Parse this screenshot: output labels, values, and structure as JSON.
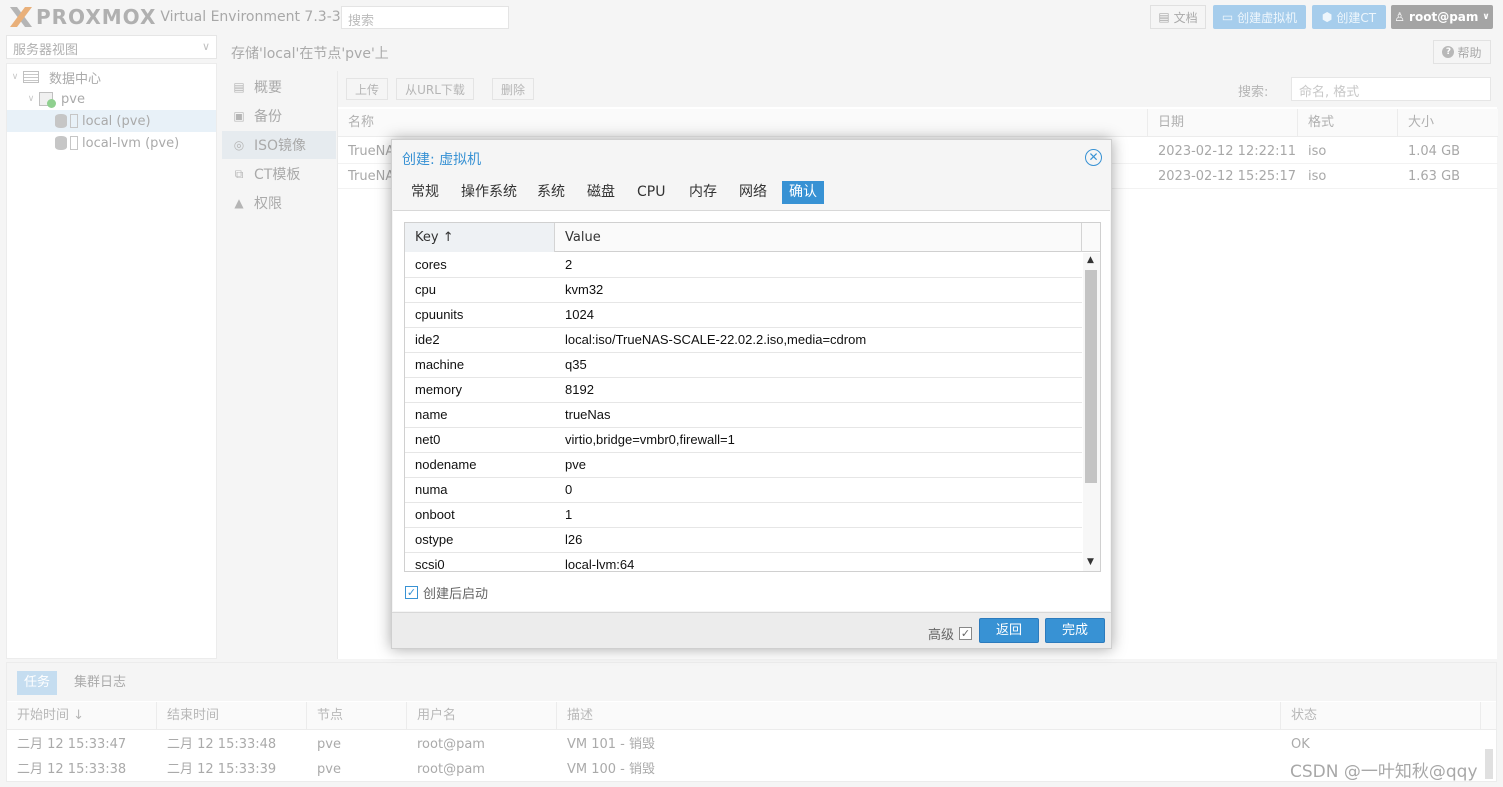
{
  "topbar": {
    "logo_text": "PROXMOX",
    "version": "Virtual Environment 7.3-3",
    "search_placeholder": "搜索",
    "docs_label": "文档",
    "create_vm_label": "创建虚拟机",
    "create_ct_label": "创建CT",
    "user_label": "root@pam"
  },
  "tree": {
    "view_label": "服务器视图",
    "items": [
      {
        "label": "数据中心",
        "icon": "datacenter-icon"
      },
      {
        "label": "pve",
        "icon": "node-icon"
      },
      {
        "label": "local (pve)",
        "icon": "storage-icon"
      },
      {
        "label": "local-lvm (pve)",
        "icon": "storage-icon"
      }
    ]
  },
  "content": {
    "title": "存储'local'在节点'pve'上",
    "help_label": "帮助"
  },
  "side_menu": {
    "items": [
      {
        "label": "概要",
        "icon": "book-icon"
      },
      {
        "label": "备份",
        "icon": "floppy-icon"
      },
      {
        "label": "ISO镜像",
        "icon": "disc-icon"
      },
      {
        "label": "CT模板",
        "icon": "template-icon"
      },
      {
        "label": "权限",
        "icon": "unlock-icon"
      }
    ]
  },
  "iso": {
    "upload_label": "上传",
    "download_url_label": "从URL下载",
    "delete_label": "删除",
    "search_label": "搜索:",
    "search_placeholder": "命名, 格式",
    "columns": [
      "名称",
      "日期",
      "格式",
      "大小"
    ],
    "rows": [
      {
        "name": "TrueNA",
        "date": "2023-02-12 12:22:11",
        "format": "iso",
        "size": "1.04 GB"
      },
      {
        "name": "TrueNA",
        "date": "2023-02-12 15:25:17",
        "format": "iso",
        "size": "1.63 GB"
      }
    ]
  },
  "modal": {
    "title": "创建: 虚拟机",
    "tabs": [
      "常规",
      "操作系统",
      "系统",
      "磁盘",
      "CPU",
      "内存",
      "网络",
      "确认"
    ],
    "active_tab": "确认",
    "key_header": "Key ↑",
    "value_header": "Value",
    "rows": [
      {
        "key": "cores",
        "value": "2"
      },
      {
        "key": "cpu",
        "value": "kvm32"
      },
      {
        "key": "cpuunits",
        "value": "1024"
      },
      {
        "key": "ide2",
        "value": "local:iso/TrueNAS-SCALE-22.02.2.iso,media=cdrom"
      },
      {
        "key": "machine",
        "value": "q35"
      },
      {
        "key": "memory",
        "value": "8192"
      },
      {
        "key": "name",
        "value": "trueNas"
      },
      {
        "key": "net0",
        "value": "virtio,bridge=vmbr0,firewall=1"
      },
      {
        "key": "nodename",
        "value": "pve"
      },
      {
        "key": "numa",
        "value": "0"
      },
      {
        "key": "onboot",
        "value": "1"
      },
      {
        "key": "ostype",
        "value": "l26"
      },
      {
        "key": "scsi0",
        "value": "local-lvm:64"
      }
    ],
    "start_after_create_label": "创建后启动",
    "advanced_label": "高级",
    "back_label": "返回",
    "finish_label": "完成"
  },
  "tasks": {
    "tabs": [
      "任务",
      "集群日志"
    ],
    "columns": [
      "开始时间 ↓",
      "结束时间",
      "节点",
      "用户名",
      "描述",
      "状态"
    ],
    "rows": [
      {
        "start": "二月 12 15:33:47",
        "end": "二月 12 15:33:48",
        "node": "pve",
        "user": "root@pam",
        "desc": "VM 101 - 销毁",
        "status": "OK"
      },
      {
        "start": "二月 12 15:33:38",
        "end": "二月 12 15:33:39",
        "node": "pve",
        "user": "root@pam",
        "desc": "VM 100 - 销毁",
        "status": ""
      }
    ]
  },
  "watermark": "CSDN @一叶知秋@qqy",
  "colors": {
    "accent": "#3892d4",
    "brand_orange": "#e57000"
  }
}
